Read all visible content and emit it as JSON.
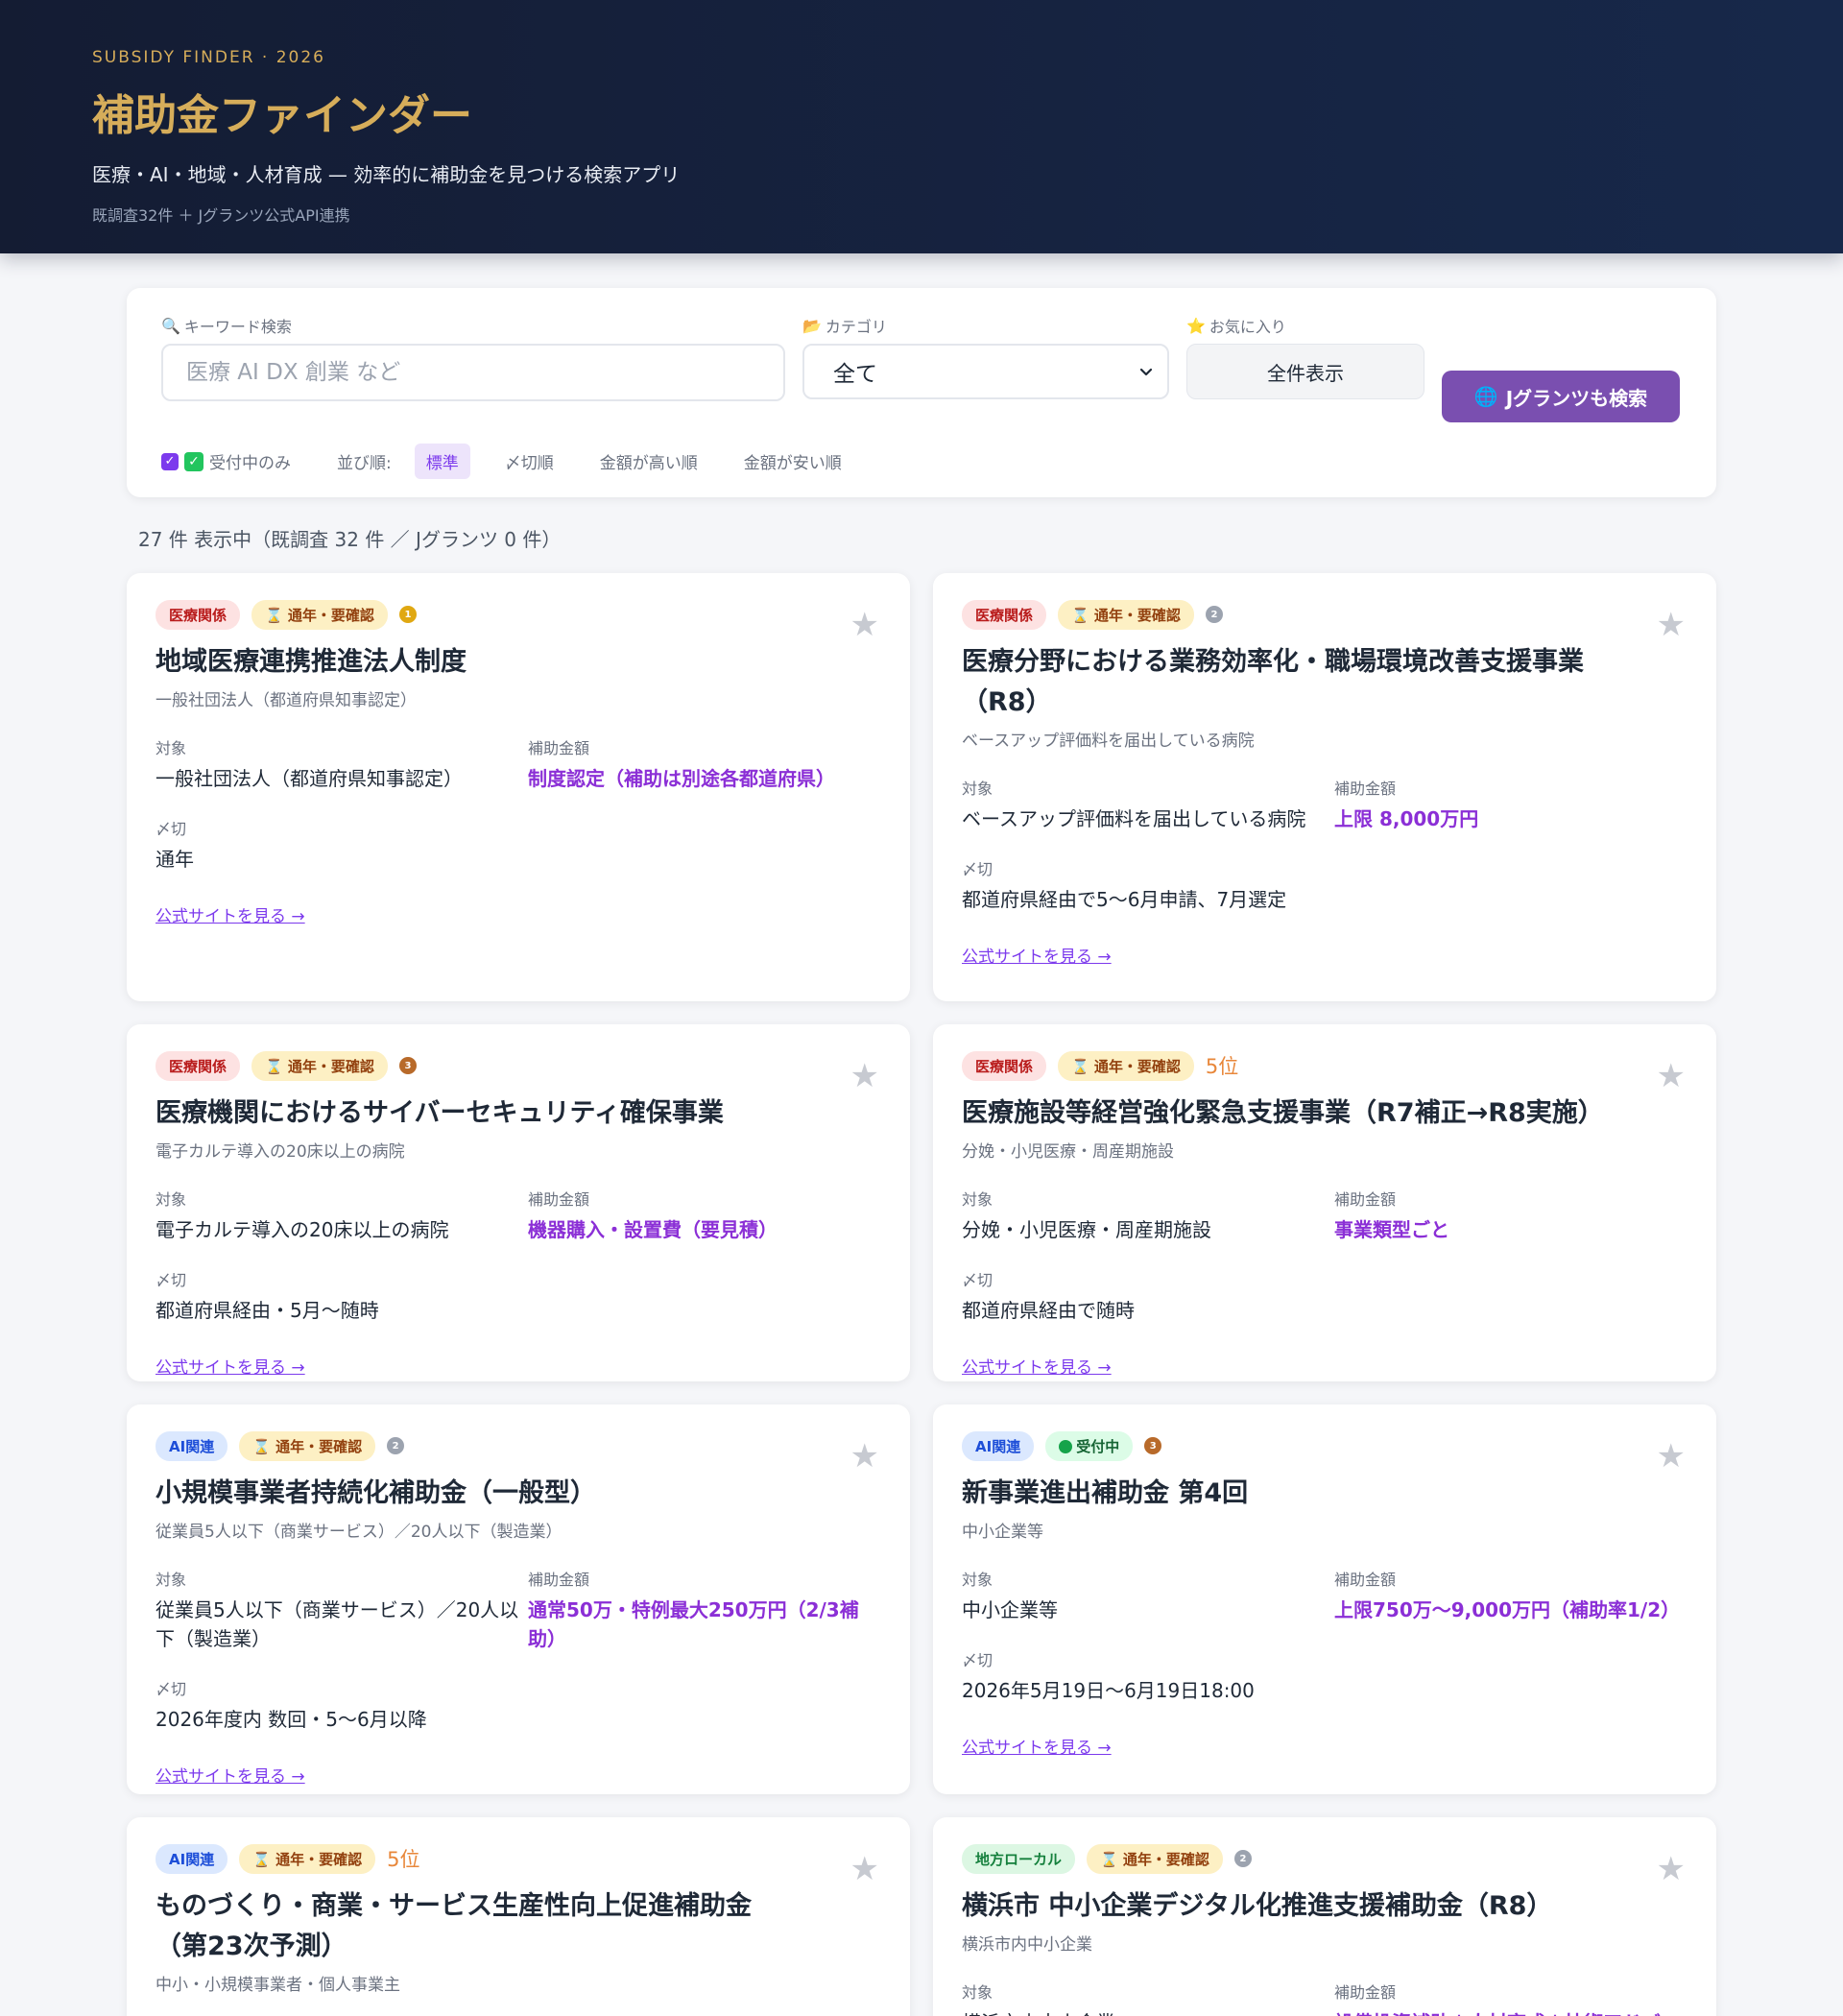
{
  "hero": {
    "eyebrow": "SUBSIDY FINDER · 2026",
    "title": "補助金ファインダー",
    "subtitle": "医療・AI・地域・人材育成 — 効率的に補助金を見つける検索アプリ",
    "note": "既調査32件 ＋ Jグランツ公式API連携"
  },
  "search": {
    "keyword_label": "キーワード検索",
    "keyword_placeholder": "医療 AI DX 創業 など",
    "keyword_value": "",
    "category_label": "カテゴリ",
    "category_value": "全て",
    "favorites_label": "お気に入り",
    "show_all_label": "全件表示",
    "jgrants_button": "Jグランツも検索",
    "open_only_label": "受付中のみ",
    "sort_label": "並び順:",
    "sort_options": [
      "標準",
      "〆切順",
      "金額が高い順",
      "金額が安い順"
    ]
  },
  "result_count": "27 件 表示中（既調査 32 件 ／ Jグランツ 0 件）",
  "labels": {
    "target": "対象",
    "amount": "補助金額",
    "deadline": "〆切",
    "link": "公式サイトを見る →"
  },
  "cards": [
    {
      "category": "医療関係",
      "status": "⌛ 通年・要確認",
      "medal": "gold",
      "rank": "",
      "title": "地域医療連携推進法人制度",
      "subtitle": "一般社団法人（都道府県知事認定）",
      "target": "一般社団法人（都道府県知事認定）",
      "amount": "制度認定（補助は別途各都道府県）",
      "deadline": "通年"
    },
    {
      "category": "医療関係",
      "status": "⌛ 通年・要確認",
      "medal": "silver",
      "rank": "",
      "title": "医療分野における業務効率化・職場環境改善支援事業（R8）",
      "subtitle": "ベースアップ評価料を届出している病院",
      "target": "ベースアップ評価料を届出している病院",
      "amount": "上限 8,000万円",
      "deadline": "都道府県経由で5〜6月申請、7月選定"
    },
    {
      "category": "医療関係",
      "status": "⌛ 通年・要確認",
      "medal": "bronze",
      "rank": "",
      "title": "医療機関におけるサイバーセキュリティ確保事業",
      "subtitle": "電子カルテ導入の20床以上の病院",
      "target": "電子カルテ導入の20床以上の病院",
      "amount": "機器購入・設置費（要見積）",
      "deadline": "都道府県経由・5月〜随時"
    },
    {
      "category": "医療関係",
      "status": "⌛ 通年・要確認",
      "medal": "",
      "rank": "5位",
      "title": "医療施設等経営強化緊急支援事業（R7補正→R8実施）",
      "subtitle": "分娩・小児医療・周産期施設",
      "target": "分娩・小児医療・周産期施設",
      "amount": "事業類型ごと",
      "deadline": "都道府県経由で随時"
    },
    {
      "category": "AI関連",
      "status": "⌛ 通年・要確認",
      "medal": "silver",
      "rank": "",
      "title": "小規模事業者持続化補助金（一般型）",
      "subtitle": "従業員5人以下（商業サービス）／20人以下（製造業）",
      "target": "従業員5人以下（商業サービス）／20人以下（製造業）",
      "amount": "通常50万・特例最大250万円（2/3補助）",
      "deadline": "2026年度内 数回・5〜6月以降"
    },
    {
      "category": "AI関連",
      "status": "受付中",
      "medal": "bronze",
      "rank": "",
      "title": "新事業進出補助金 第4回",
      "subtitle": "中小企業等",
      "target": "中小企業等",
      "amount": "上限750万〜9,000万円（補助率1/2）",
      "deadline": "2026年5月19日〜6月19日18:00"
    },
    {
      "category": "AI関連",
      "status": "⌛ 通年・要確認",
      "medal": "",
      "rank": "5位",
      "title": "ものづくり・商業・サービス生産性向上促進補助金（第23次予測）",
      "subtitle": "中小・小規模事業者・個人事業主",
      "target": "",
      "amount": "",
      "deadline": ""
    },
    {
      "category": "地方ローカル",
      "status": "⌛ 通年・要確認",
      "medal": "silver",
      "rank": "",
      "title": "横浜市 中小企業デジタル化推進支援補助金（R8）",
      "subtitle": "横浜市内中小企業",
      "target": "横浜市内中小企業",
      "amount": "設備投資補助＋人材育成＋技術アドバ",
      "deadline": ""
    }
  ]
}
